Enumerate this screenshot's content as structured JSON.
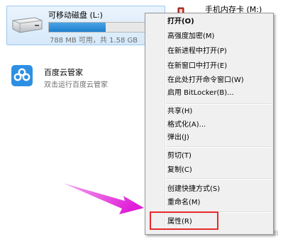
{
  "drive": {
    "name": "可移动磁盘 (L:)",
    "usage_fraction": 0.5,
    "info": "788 MB 可用，共 1.58 GB"
  },
  "phone": {
    "label": "手机内存卡 (M:)"
  },
  "app": {
    "name": "百度云管家",
    "description": "双击运行百度云管家"
  },
  "context_menu": {
    "items": [
      "打开(O)",
      "高强度加密(M)",
      "在新进程中打开(P)",
      "在新窗口中打开(E)",
      "在此处打开命令窗口(W)",
      "启用 BitLocker(B)...",
      "共享(H)",
      "格式化(A)...",
      "弹出(J)",
      "剪切(T)",
      "复制(C)",
      "创建快捷方式(S)",
      "重命名(M)",
      "属性(R)"
    ]
  },
  "colors": {
    "highlight_box": "#e8292a",
    "arrow": "#e01fd8",
    "progress": "#1e7fcf"
  },
  "icons": [
    "usb-drive-icon",
    "phone-card-icon",
    "baidu-cloud-icon"
  ]
}
